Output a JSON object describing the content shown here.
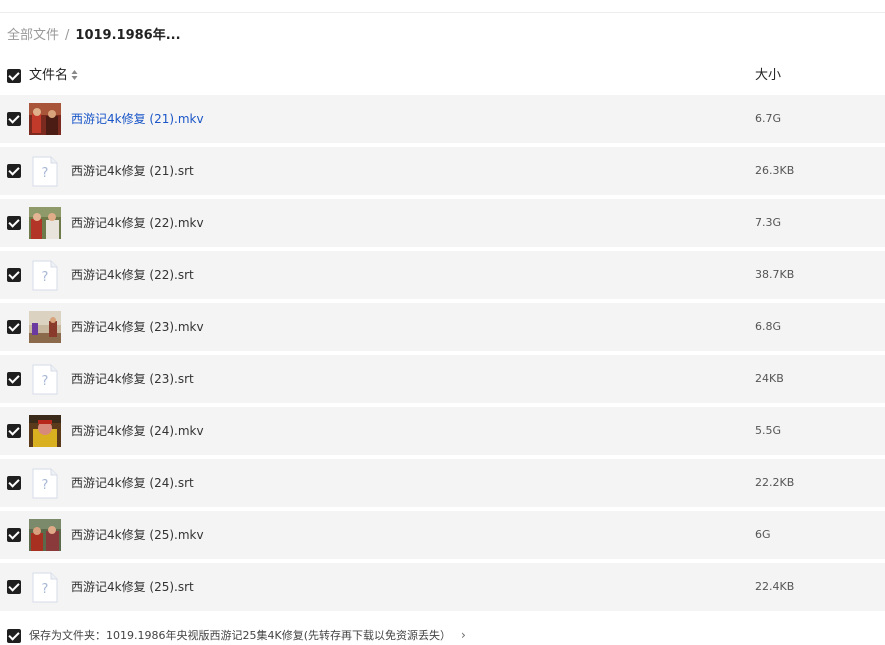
{
  "breadcrumb": {
    "root": "全部文件",
    "separator": "/",
    "current": "1019.1986年..."
  },
  "table": {
    "col_name": "文件名",
    "col_size": "大小",
    "rows": [
      {
        "name": "西游记4k修复 (21).mkv",
        "size": "6.7G",
        "kind": "video",
        "active": true
      },
      {
        "name": "西游记4k修复 (21).srt",
        "size": "26.3KB",
        "kind": "unknown",
        "active": false
      },
      {
        "name": "西游记4k修复 (22).mkv",
        "size": "7.3G",
        "kind": "video",
        "active": false
      },
      {
        "name": "西游记4k修复 (22).srt",
        "size": "38.7KB",
        "kind": "unknown",
        "active": false
      },
      {
        "name": "西游记4k修复 (23).mkv",
        "size": "6.8G",
        "kind": "video",
        "active": false
      },
      {
        "name": "西游记4k修复 (23).srt",
        "size": "24KB",
        "kind": "unknown",
        "active": false
      },
      {
        "name": "西游记4k修复 (24).mkv",
        "size": "5.5G",
        "kind": "video",
        "active": false
      },
      {
        "name": "西游记4k修复 (24).srt",
        "size": "22.2KB",
        "kind": "unknown",
        "active": false
      },
      {
        "name": "西游记4k修复 (25).mkv",
        "size": "6G",
        "kind": "video",
        "active": false
      },
      {
        "name": "西游记4k修复 (25).srt",
        "size": "22.4KB",
        "kind": "unknown",
        "active": false
      }
    ]
  },
  "footer": {
    "save_label": "保存为文件夹：1019.1986年央视版西游记25集4K修复(先转存再下载以免资源丢失）",
    "chevron": "›"
  },
  "colors": {
    "row_bg": "#f4f4f5",
    "link_blue": "#1a56c7",
    "checkbox": "#1f1f1f"
  }
}
